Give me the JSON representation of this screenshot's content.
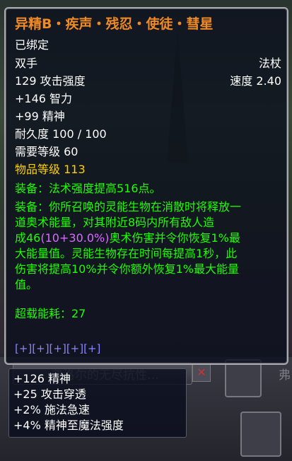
{
  "tooltip": {
    "title": "异精B・疾声・残忍・使徒・彗星",
    "binding": "已绑定",
    "hand": "双手",
    "item_type": "法杖",
    "attack_power": "129 攻击强度",
    "speed": "速度 2.40",
    "stat_int": "+146 智力",
    "stat_spirit": "+99 精神",
    "durability": "耐久度 100 / 100",
    "required_level": "需要等级 60",
    "item_level": "物品等级 113",
    "equip1": "装备：法术强度提高516点。",
    "equip2": {
      "line1": "装备：你所召唤的灵能生物在消散时将释放一",
      "line2": "道奥术能量，对其附近8码内所有敌人造",
      "line3_prefix": "成46",
      "line3_scaling": "(10+30.0%)",
      "line3_suffix": "奥术伤害并令你恢复1%最",
      "line4": "大能量值。灵能生物存在时间每提高1秒，此",
      "line5": "伤害将提高10%并令你额外恢复1%最大能量",
      "line6": "值。"
    },
    "overload": "超载能耗：27",
    "sockets": "[+][+][+][+][+]"
  },
  "bonus_stats": [
    "+126 精神",
    "+25 攻击穿透",
    "+2% 施法急速",
    "+4% 精神至魔法强度"
  ],
  "background": {
    "namebar_text": "弗洛尔的无尽抗性…",
    "close_glyph": "✕",
    "right_partial": "弗"
  }
}
